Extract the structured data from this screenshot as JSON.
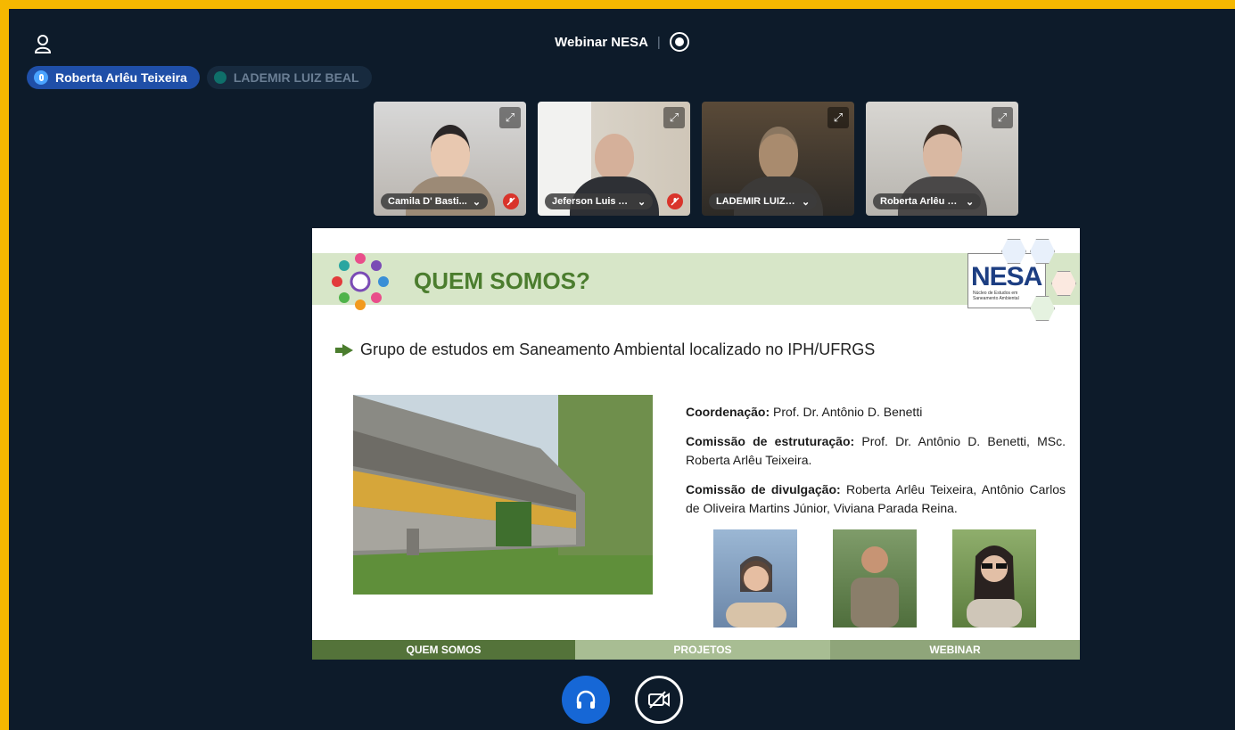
{
  "meeting": {
    "title": "Webinar NESA"
  },
  "talking": [
    {
      "name": "Roberta Arlêu Teixeira",
      "active": true
    },
    {
      "name": "LADEMIR LUIZ BEAL",
      "active": false
    }
  ],
  "video_tiles": [
    {
      "name": "Camila D' Basti...",
      "muted": true
    },
    {
      "name": "Jeferson Luis Al...",
      "muted": true
    },
    {
      "name": "LADEMIR LUIZ BEAL",
      "muted": false
    },
    {
      "name": "Roberta Arlêu Teix...",
      "muted": false
    }
  ],
  "slide": {
    "title": "QUEM SOMOS?",
    "logo_text": "NESA",
    "logo_subtitle": "Núcleo de Estudos em Saneamento Ambiental",
    "bullet": "Grupo de estudos em Saneamento Ambiental localizado no IPH/UFRGS",
    "coordenacao_label": "Coordenação:",
    "coordenacao_value": " Prof. Dr. Antônio D. Benetti",
    "estruturacao_label": "Comissão de estruturação:",
    "estruturacao_value": " Prof. Dr. Antônio D. Benetti, MSc. Roberta Arlêu Teixeira.",
    "divulgacao_label": "Comissão de divulgação:",
    "divulgacao_value": " Roberta Arlêu Teixeira, Antônio Carlos de Oliveira Martins Júnior, Viviana Parada Reina.",
    "tabs": [
      "QUEM SOMOS",
      "PROJETOS",
      "WEBINAR"
    ]
  },
  "colors": {
    "frame": "#f5b800",
    "background": "#0d1b2a",
    "accent_blue": "#1667d6",
    "slide_green": "#4b7d2e",
    "slide_header": "#d7e6c8",
    "muted_red": "#d9342b"
  },
  "icons": [
    "user-icon",
    "record-icon",
    "microphone-icon",
    "expand-icon",
    "mic-muted-icon",
    "headphones-icon",
    "video-off-icon"
  ]
}
